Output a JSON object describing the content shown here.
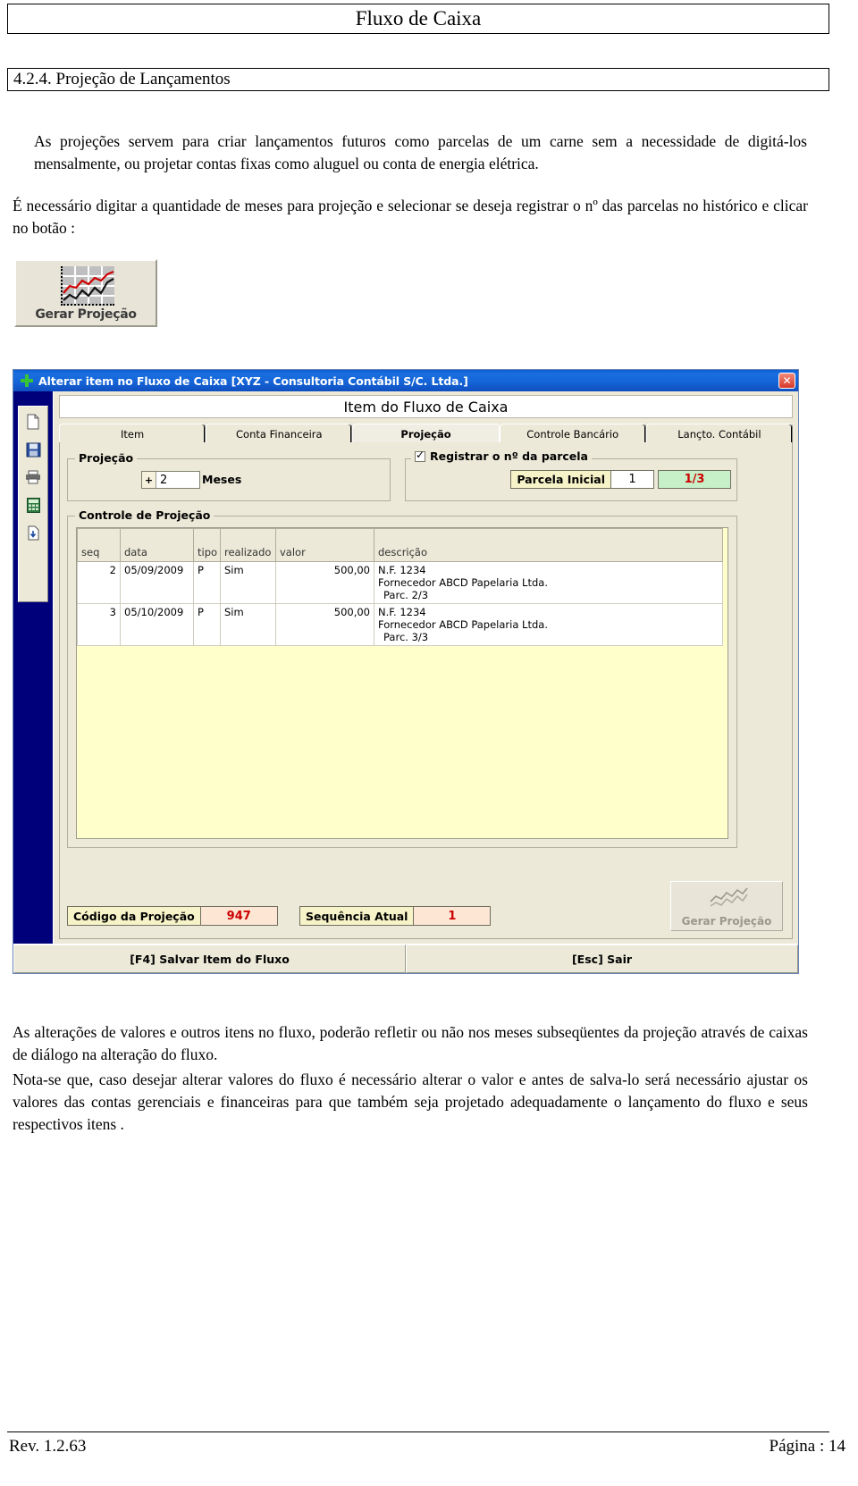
{
  "document": {
    "header_title": "Fluxo de Caixa",
    "section_title": "4.2.4. Projeção de Lançamentos",
    "paragraph_1": "As projeções servem para criar lançamentos futuros como parcelas de um carne sem a necessidade de digitá-los mensalmente, ou projetar contas fixas como aluguel ou conta de energia elétrica.",
    "paragraph_2": "É necessário digitar a quantidade de meses para projeção e selecionar se deseja registrar o nº das parcelas no histórico e clicar no botão :",
    "paragraph_3": "As alterações de valores e outros itens no fluxo, poderão refletir ou não nos meses subseqüentes da projeção através de caixas de diálogo na alteração do fluxo.",
    "paragraph_4": "Nota-se que,  caso desejar alterar valores do fluxo é necessário alterar o valor e antes de salva-lo  será necessário ajustar os valores das contas gerenciais e financeiras para que também seja projetado adequadamente o lançamento do fluxo e seus respectivos itens .",
    "footer_rev": "Rev. 1.2.63",
    "footer_page": "Página :  14"
  },
  "gerar_button": {
    "label": "Gerar Projeção",
    "icon": "line-chart-icon"
  },
  "app": {
    "titlebar": {
      "title": "Alterar item no Fluxo de Caixa [XYZ - Consultoria Contábil S/C. Ltda.]",
      "app_icon": "plus-icon",
      "close_label": "✕"
    },
    "sidebar": {
      "buttons": [
        {
          "name": "new-document-icon",
          "glyph": "document"
        },
        {
          "name": "save-disk-icon",
          "glyph": "disk"
        },
        {
          "name": "print-icon",
          "glyph": "printer"
        },
        {
          "name": "calculator-icon",
          "glyph": "calculator"
        },
        {
          "name": "export-icon",
          "glyph": "export"
        }
      ]
    },
    "content_header": "Item do Fluxo de Caixa",
    "tabs": [
      {
        "label": "Item",
        "active": false
      },
      {
        "label": "Conta Financeira",
        "active": false
      },
      {
        "label": "Projeção",
        "active": true
      },
      {
        "label": "Controle Bancário",
        "active": false
      },
      {
        "label": "Lançto. Contábil",
        "active": false
      }
    ],
    "projecao_group": {
      "title": "Projeção",
      "spin_button": "+",
      "months_value": "2",
      "months_label": "Meses"
    },
    "registrar_group": {
      "checkbox_label": "Registrar o nº da parcela",
      "checked": true,
      "parcela_label": "Parcela Inicial",
      "parcela_value": "1",
      "parcela_fraction": "1/3"
    },
    "controle_group": {
      "title": "Controle de Projeção",
      "columns": [
        "seq",
        "data",
        "tipo",
        "realizado",
        "valor",
        "descrição"
      ],
      "rows": [
        {
          "seq": "2",
          "data": "05/09/2009",
          "tipo": "P",
          "realizado": "Sim",
          "valor": "500,00",
          "desc_line1": "N.F. 1234",
          "desc_line2": "Fornecedor ABCD Papelaria Ltda.",
          "desc_line3": "Parc. 2/3"
        },
        {
          "seq": "3",
          "data": "05/10/2009",
          "tipo": "P",
          "realizado": "Sim",
          "valor": "500,00",
          "desc_line1": "N.F. 1234",
          "desc_line2": "Fornecedor ABCD Papelaria Ltda.",
          "desc_line3": "Parc. 3/3"
        }
      ]
    },
    "footer_fields": {
      "codigo_label": "Código da Projeção",
      "codigo_value": "947",
      "sequencia_label": "Sequência Atual",
      "sequencia_value": "1",
      "gerar_button_label": "Gerar Projeção"
    },
    "statusbar": {
      "save_label": "[F4] Salvar Item do Fluxo",
      "exit_label": "[Esc] Sair"
    },
    "colors": {
      "titlebar_blue": "#1565d8",
      "sidebar_navy": "#00007b",
      "face": "#ece9d8",
      "grid_background": "#ffffcc",
      "label_yellow": "#f7f3c8",
      "value_peach": "#fde6d4",
      "fraction_green": "#c8f0c8",
      "red_text": "#cc0000"
    }
  }
}
